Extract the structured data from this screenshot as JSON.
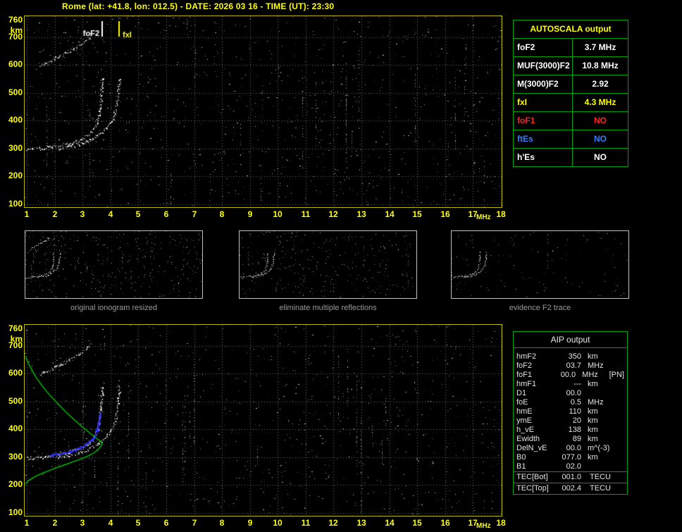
{
  "title": "Rome (lat: +41.8, lon: 012.5) - DATE: 2026 03 16 - TIME (UT): 23:30",
  "colors": {
    "accent_yellow": "#ffff00",
    "table_border_green": "#00a400",
    "profile_green": "#00c800",
    "fit_blue": "#2b2bff",
    "caption_gray": "#9a9a9a",
    "no_red": "#ff2020",
    "no_blue": "#2f7fff"
  },
  "autoscala_table": {
    "header": "AUTOSCALA output",
    "rows": [
      {
        "label": "foF2",
        "value": "3.7 MHz",
        "color": "#ffffff"
      },
      {
        "label": "MUF(3000)F2",
        "value": "10.8 MHz",
        "color": "#ffffff"
      },
      {
        "label": "M(3000)F2",
        "value": "2.92",
        "color": "#ffffff"
      },
      {
        "label": "fxI",
        "value": "4.3 MHz",
        "color": "#ffff00"
      },
      {
        "label": "foF1",
        "value": "NO",
        "color": "#ff2020"
      },
      {
        "label": "ftEs",
        "value": "NO",
        "color": "#2f7fff"
      },
      {
        "label": "h'Es",
        "value": "NO",
        "color": "#ffffff"
      }
    ]
  },
  "aip_table": {
    "header": "AIP output",
    "rows": [
      {
        "label": "hmF2",
        "value": "350",
        "unit": "km",
        "note": ""
      },
      {
        "label": "foF2",
        "value": "03.7",
        "unit": "MHz",
        "note": ""
      },
      {
        "label": "foF1",
        "value": "00.0",
        "unit": "MHz",
        "note": "[PN]"
      },
      {
        "label": "hmF1",
        "value": "---",
        "unit": "km",
        "note": ""
      },
      {
        "label": "D1",
        "value": "00.0",
        "unit": "",
        "note": ""
      },
      {
        "label": "foE",
        "value": "0.5",
        "unit": "MHz",
        "note": ""
      },
      {
        "label": "hmE",
        "value": "110",
        "unit": "km",
        "note": ""
      },
      {
        "label": "ymE",
        "value": "20",
        "unit": "km",
        "note": ""
      },
      {
        "label": "h_vE",
        "value": "138",
        "unit": "km",
        "note": ""
      },
      {
        "label": "Ewidth",
        "value": "89",
        "unit": "km",
        "note": ""
      },
      {
        "label": "DelN_vE",
        "value": "00.0",
        "unit": "m^(-3)",
        "note": ""
      },
      {
        "label": "B0",
        "value": "077.0",
        "unit": "km",
        "note": ""
      },
      {
        "label": "B1",
        "value": "02.0",
        "unit": "",
        "note": ""
      }
    ],
    "tec_rows": [
      {
        "label": "TEC[Bot]",
        "value": "001.0",
        "unit": "TECU"
      },
      {
        "label": "TEC[Top]",
        "value": "002.4",
        "unit": "TECU"
      }
    ]
  },
  "thumbnails": [
    {
      "caption": "original ionogram resized",
      "seed": 11,
      "noise": 380,
      "streaks": 8,
      "traces": [
        "F2-ordinary",
        "F2-extraordinary",
        "second-reflection"
      ]
    },
    {
      "caption": "eliminate multiple reflections",
      "seed": 12,
      "noise": 300,
      "streaks": 7,
      "traces": [
        "F2-ordinary",
        "F2-extraordinary"
      ]
    },
    {
      "caption": "evidence F2 trace",
      "seed": 13,
      "noise": 110,
      "streaks": 3,
      "traces": [
        "F2-ordinary",
        "F2-extraordinary"
      ]
    }
  ],
  "chart_data": [
    {
      "type": "scatter",
      "title": "ionogram with AUTOSCALA scaled characteristics",
      "xlabel": "MHz",
      "ylabel": "km",
      "xlim": [
        1,
        18
      ],
      "ylim": [
        100,
        760
      ],
      "grid": true,
      "x_ticks": [
        1,
        2,
        3,
        4,
        5,
        6,
        7,
        8,
        9,
        10,
        11,
        12,
        13,
        14,
        15,
        16,
        17,
        18
      ],
      "y_ticks": [
        760,
        700,
        600,
        500,
        400,
        300,
        200,
        100
      ],
      "markers": [
        {
          "name": "foF2",
          "freq": 3.7,
          "color": "#ffffff",
          "labelSide": "left"
        },
        {
          "name": "fxI",
          "freq": 4.3,
          "color": "#ffff00",
          "labelSide": "right"
        }
      ],
      "traces": [
        {
          "name": "F2-ordinary",
          "color": "#ffffff",
          "points": [
            [
              1.0,
              296
            ],
            [
              1.3,
              299
            ],
            [
              1.6,
              302
            ],
            [
              1.9,
              306
            ],
            [
              2.2,
              311
            ],
            [
              2.5,
              318
            ],
            [
              2.8,
              327
            ],
            [
              3.0,
              336
            ],
            [
              3.2,
              349
            ],
            [
              3.35,
              362
            ],
            [
              3.45,
              376
            ],
            [
              3.52,
              392
            ],
            [
              3.58,
              412
            ],
            [
              3.62,
              435
            ],
            [
              3.65,
              460
            ],
            [
              3.67,
              490
            ],
            [
              3.69,
              525
            ],
            [
              3.7,
              558
            ]
          ]
        },
        {
          "name": "F2-extraordinary",
          "color": "#ffffff",
          "points": [
            [
              2.1,
              300
            ],
            [
              2.4,
              305
            ],
            [
              2.7,
              311
            ],
            [
              3.0,
              319
            ],
            [
              3.2,
              327
            ],
            [
              3.4,
              338
            ],
            [
              3.6,
              351
            ],
            [
              3.8,
              367
            ],
            [
              3.95,
              385
            ],
            [
              4.08,
              405
            ],
            [
              4.17,
              428
            ],
            [
              4.23,
              455
            ],
            [
              4.27,
              488
            ],
            [
              4.3,
              525
            ],
            [
              4.32,
              556
            ]
          ]
        },
        {
          "name": "second-reflection",
          "color": "#e0e0e0",
          "points": [
            [
              1.5,
              598
            ],
            [
              1.8,
              612
            ],
            [
              2.1,
              627
            ],
            [
              2.4,
              642
            ],
            [
              2.7,
              659
            ],
            [
              3.0,
              678
            ],
            [
              3.2,
              696
            ],
            [
              3.3,
              712
            ]
          ]
        }
      ],
      "noise": {
        "seed": 7,
        "count": 1050,
        "streaks": 26
      }
    },
    {
      "type": "scatter",
      "title": "ionogram with AIP fitted trace and electron density profile",
      "xlabel": "MHz",
      "ylabel": "km",
      "xlim": [
        1,
        18
      ],
      "ylim": [
        100,
        760
      ],
      "grid": true,
      "x_ticks": [
        1,
        2,
        3,
        4,
        5,
        6,
        7,
        8,
        9,
        10,
        11,
        12,
        13,
        14,
        15,
        16,
        17,
        18
      ],
      "y_ticks": [
        760,
        700,
        600,
        500,
        400,
        300,
        200,
        100
      ],
      "traces": [
        {
          "name": "F2-ordinary",
          "color": "#ffffff",
          "points": [
            [
              1.0,
              296
            ],
            [
              1.3,
              299
            ],
            [
              1.6,
              302
            ],
            [
              1.9,
              306
            ],
            [
              2.2,
              311
            ],
            [
              2.5,
              318
            ],
            [
              2.8,
              327
            ],
            [
              3.0,
              336
            ],
            [
              3.2,
              349
            ],
            [
              3.35,
              362
            ],
            [
              3.45,
              376
            ],
            [
              3.52,
              392
            ],
            [
              3.58,
              412
            ],
            [
              3.62,
              435
            ],
            [
              3.65,
              460
            ],
            [
              3.67,
              490
            ],
            [
              3.69,
              525
            ],
            [
              3.7,
              558
            ]
          ]
        },
        {
          "name": "F2-extraordinary",
          "color": "#ffffff",
          "points": [
            [
              2.1,
              300
            ],
            [
              2.4,
              305
            ],
            [
              2.7,
              311
            ],
            [
              3.0,
              319
            ],
            [
              3.2,
              327
            ],
            [
              3.4,
              338
            ],
            [
              3.6,
              351
            ],
            [
              3.8,
              367
            ],
            [
              3.95,
              385
            ],
            [
              4.08,
              405
            ],
            [
              4.17,
              428
            ],
            [
              4.23,
              455
            ],
            [
              4.27,
              488
            ],
            [
              4.3,
              525
            ],
            [
              4.32,
              556
            ]
          ]
        },
        {
          "name": "second-reflection",
          "color": "#e0e0e0",
          "points": [
            [
              1.5,
              598
            ],
            [
              1.8,
              612
            ],
            [
              2.1,
              627
            ],
            [
              2.4,
              642
            ],
            [
              2.7,
              659
            ],
            [
              3.0,
              678
            ],
            [
              3.2,
              696
            ],
            [
              3.3,
              712
            ]
          ]
        }
      ],
      "fitted_trace": {
        "name": "autoscala-fitted-trace",
        "color": "#2b2bff",
        "points": [
          [
            1.85,
            305
          ],
          [
            2.1,
            309
          ],
          [
            2.35,
            314
          ],
          [
            2.6,
            320
          ],
          [
            2.85,
            328
          ],
          [
            3.05,
            338
          ],
          [
            3.2,
            349
          ],
          [
            3.35,
            362
          ],
          [
            3.45,
            376
          ],
          [
            3.52,
            392
          ],
          [
            3.58,
            412
          ],
          [
            3.62,
            435
          ],
          [
            3.65,
            458
          ]
        ]
      },
      "profile": {
        "name": "electron-density-profile",
        "color": "#00c800",
        "points": [
          [
            0.95,
            662
          ],
          [
            1.1,
            628
          ],
          [
            1.3,
            592
          ],
          [
            1.55,
            556
          ],
          [
            1.85,
            520
          ],
          [
            2.15,
            488
          ],
          [
            2.45,
            458
          ],
          [
            2.75,
            430
          ],
          [
            3.05,
            404
          ],
          [
            3.3,
            384
          ],
          [
            3.5,
            368
          ],
          [
            3.63,
            358
          ],
          [
            3.7,
            351
          ],
          [
            3.67,
            342
          ],
          [
            3.58,
            330
          ],
          [
            3.44,
            318
          ],
          [
            3.25,
            307
          ],
          [
            3.02,
            297
          ],
          [
            2.78,
            288
          ],
          [
            2.53,
            279
          ],
          [
            2.28,
            270
          ],
          [
            2.02,
            261
          ],
          [
            1.77,
            251
          ],
          [
            1.52,
            241
          ],
          [
            1.27,
            229
          ],
          [
            1.06,
            216
          ],
          [
            0.95,
            204
          ]
        ]
      },
      "noise": {
        "seed": 21,
        "count": 950,
        "streaks": 22
      }
    }
  ]
}
